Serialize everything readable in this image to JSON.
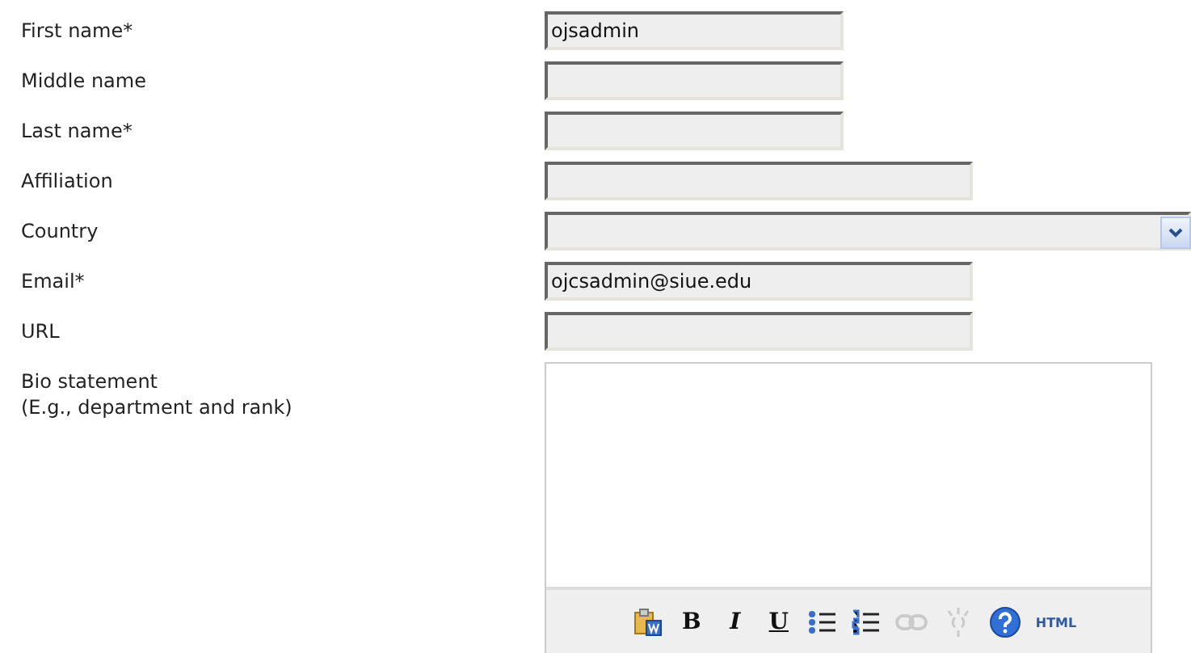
{
  "fields": [
    {
      "label": "First name*",
      "kind": "short",
      "value": "ojsadmin"
    },
    {
      "label": "Middle name",
      "kind": "short"
    },
    {
      "label": "Last name*",
      "kind": "short"
    },
    {
      "label": "Affiliation",
      "kind": "long"
    },
    {
      "label": "Country",
      "kind": "select"
    },
    {
      "label": "Email*",
      "kind": "long",
      "value": "ojcsadmin@siue.edu"
    },
    {
      "label": "URL",
      "kind": "long"
    },
    {
      "label": "Bio statement",
      "hint": "(E.g., department and rank)",
      "kind": "editor"
    }
  ],
  "toolbar": [
    {
      "kind": "paste-word",
      "disabled": false
    },
    {
      "kind": "bold",
      "text": "B",
      "disabled": false
    },
    {
      "kind": "italic",
      "text": "I",
      "disabled": false
    },
    {
      "kind": "underline",
      "text": "U",
      "disabled": false
    },
    {
      "kind": "bullets",
      "disabled": false
    },
    {
      "kind": "numbers",
      "disabled": false
    },
    {
      "kind": "link",
      "disabled": true
    },
    {
      "kind": "unlink",
      "disabled": true
    },
    {
      "kind": "help",
      "disabled": false
    },
    {
      "kind": "html",
      "text": "HTML",
      "disabled": false
    }
  ]
}
